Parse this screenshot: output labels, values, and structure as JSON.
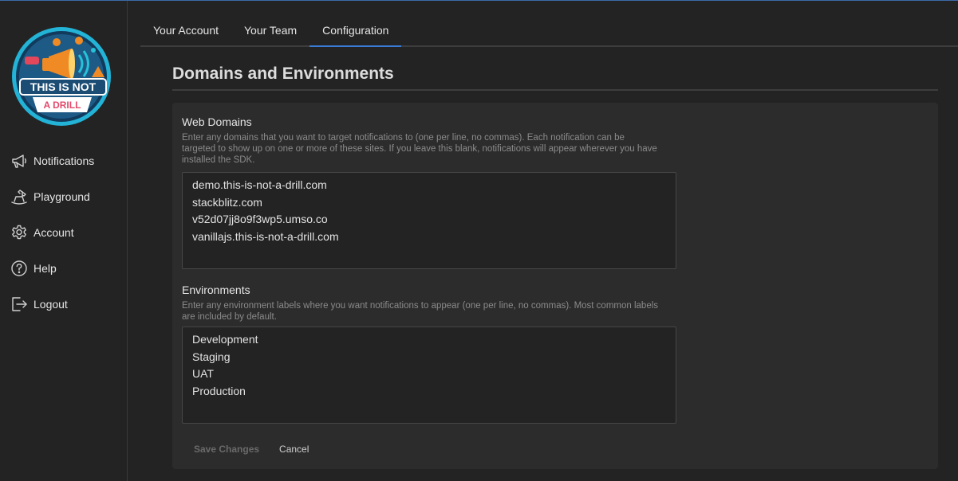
{
  "app": {
    "logo_text_line1": "THIS IS NOT",
    "logo_text_line2": "A DRILL"
  },
  "sidebar": {
    "items": [
      {
        "label": "Notifications",
        "icon": "megaphone-icon"
      },
      {
        "label": "Playground",
        "icon": "rocking-horse-icon"
      },
      {
        "label": "Account",
        "icon": "gear-icon"
      },
      {
        "label": "Help",
        "icon": "question-circle-icon"
      },
      {
        "label": "Logout",
        "icon": "logout-icon"
      }
    ]
  },
  "tabs": [
    {
      "label": "Your Account",
      "active": false
    },
    {
      "label": "Your Team",
      "active": false
    },
    {
      "label": "Configuration",
      "active": true
    }
  ],
  "page": {
    "title": "Domains and Environments"
  },
  "web_domains": {
    "label": "Web Domains",
    "help": "Enter any domains that you want to target notifications to (one per line, no commas). Each notification can be targeted to show up on one or more of these sites. If you leave this blank, notifications will appear wherever you have installed the SDK.",
    "value": "demo.this-is-not-a-drill.com\nstackblitz.com\nv52d07jj8o9f3wp5.umso.co\nvanillajs.this-is-not-a-drill.com"
  },
  "environments": {
    "label": "Environments",
    "help": "Enter any environment labels where you want notifications to appear (one per line, no commas). Most common labels are included by default.",
    "value": "Development\nStaging\nUAT\nProduction"
  },
  "actions": {
    "save_label": "Save Changes",
    "cancel_label": "Cancel"
  },
  "colors": {
    "background": "#232323",
    "card": "#2c2c2c",
    "accent": "#3a7bd5"
  }
}
